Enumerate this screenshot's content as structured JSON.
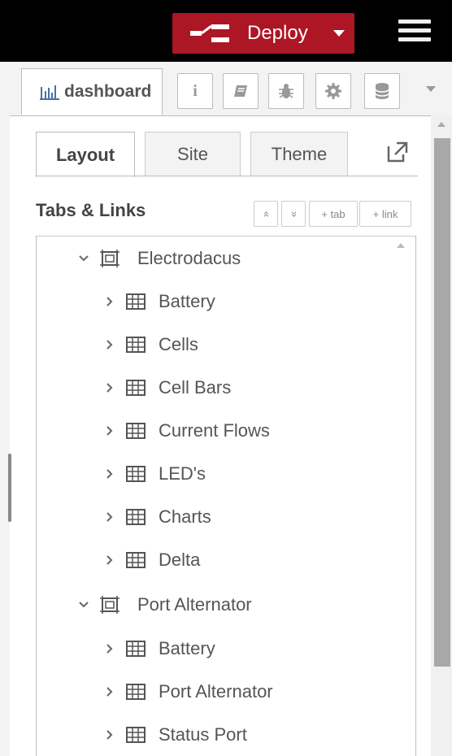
{
  "header": {
    "deploy_label": "Deploy",
    "deploy_color": "#ad1625",
    "menu_icon": "hamburger-icon"
  },
  "sidebar_tabs": {
    "active_label": "dashboard",
    "active_icon": "bar-chart-icon",
    "buttons": [
      {
        "name": "info",
        "icon": "info-icon",
        "glyph": "i"
      },
      {
        "name": "help",
        "icon": "book-icon"
      },
      {
        "name": "debug",
        "icon": "bug-icon"
      },
      {
        "name": "config",
        "icon": "gear-icon"
      },
      {
        "name": "context",
        "icon": "database-icon"
      }
    ]
  },
  "panel_tabs": [
    {
      "label": "Layout",
      "active": true
    },
    {
      "label": "Site",
      "active": false
    },
    {
      "label": "Theme",
      "active": false
    }
  ],
  "section": {
    "title": "Tabs & Links",
    "collapse_all": "»",
    "expand_all": "«",
    "add_tab": "+ tab",
    "add_link": "+ link"
  },
  "tree": [
    {
      "label": "Electrodacus",
      "kind": "tab",
      "expanded": true
    },
    {
      "label": "Battery",
      "kind": "group"
    },
    {
      "label": "Cells",
      "kind": "group"
    },
    {
      "label": "Cell Bars",
      "kind": "group"
    },
    {
      "label": "Current Flows",
      "kind": "group"
    },
    {
      "label": "LED's",
      "kind": "group"
    },
    {
      "label": "Charts",
      "kind": "group"
    },
    {
      "label": "Delta",
      "kind": "group"
    },
    {
      "label": "Port Alternator",
      "kind": "tab",
      "expanded": true
    },
    {
      "label": "Battery",
      "kind": "group"
    },
    {
      "label": "Port Alternator",
      "kind": "group"
    },
    {
      "label": "Status Port",
      "kind": "group"
    }
  ]
}
